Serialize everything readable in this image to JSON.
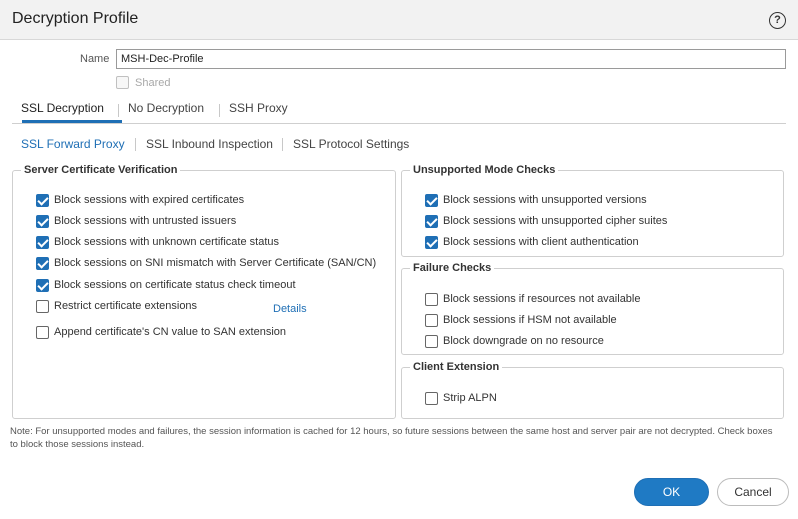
{
  "dialog": {
    "title": "Decryption Profile",
    "help_icon": "help-circle-icon",
    "help_symbol": "?"
  },
  "form": {
    "name_label": "Name",
    "name_value": "MSH-Dec-Profile",
    "shared_label": "Shared",
    "shared_checked": false
  },
  "tabs": [
    {
      "label": "SSL Decryption",
      "active": true
    },
    {
      "label": "No Decryption",
      "active": false
    },
    {
      "label": "SSH Proxy",
      "active": false
    }
  ],
  "subtabs": [
    {
      "label": "SSL Forward Proxy",
      "active": true
    },
    {
      "label": "SSL Inbound Inspection",
      "active": false
    },
    {
      "label": "SSL Protocol Settings",
      "active": false
    }
  ],
  "server_cert": {
    "legend": "Server Certificate Verification",
    "items": [
      {
        "label": "Block sessions with expired certificates",
        "checked": true
      },
      {
        "label": "Block sessions with untrusted issuers",
        "checked": true
      },
      {
        "label": "Block sessions with unknown certificate status",
        "checked": true
      },
      {
        "label": "Block sessions on SNI mismatch with Server Certificate (SAN/CN)",
        "checked": true
      },
      {
        "label": "Block sessions on certificate status check timeout",
        "checked": true
      },
      {
        "label": "Restrict certificate extensions",
        "checked": false
      },
      {
        "label": "Append certificate's CN value to SAN extension",
        "checked": false
      }
    ],
    "details_link": "Details"
  },
  "unsupported_mode": {
    "legend": "Unsupported Mode Checks",
    "items": [
      {
        "label": "Block sessions with unsupported versions",
        "checked": true
      },
      {
        "label": "Block sessions with unsupported cipher suites",
        "checked": true
      },
      {
        "label": "Block sessions with client authentication",
        "checked": true
      }
    ]
  },
  "failure_checks": {
    "legend": "Failure Checks",
    "items": [
      {
        "label": "Block sessions if resources not available",
        "checked": false
      },
      {
        "label": "Block sessions if HSM not available",
        "checked": false
      },
      {
        "label": "Block downgrade on no resource",
        "checked": false
      }
    ]
  },
  "client_extension": {
    "legend": "Client Extension",
    "items": [
      {
        "label": "Strip ALPN",
        "checked": false
      }
    ]
  },
  "note": "Note: For unsupported modes and failures, the session information is cached for 12 hours, so future sessions between the same host and server pair are not decrypted. Check boxes to block those sessions instead.",
  "buttons": {
    "ok": "OK",
    "cancel": "Cancel"
  },
  "colors": {
    "accent": "#1f6fb5",
    "ok_button": "#1f7ac4"
  }
}
